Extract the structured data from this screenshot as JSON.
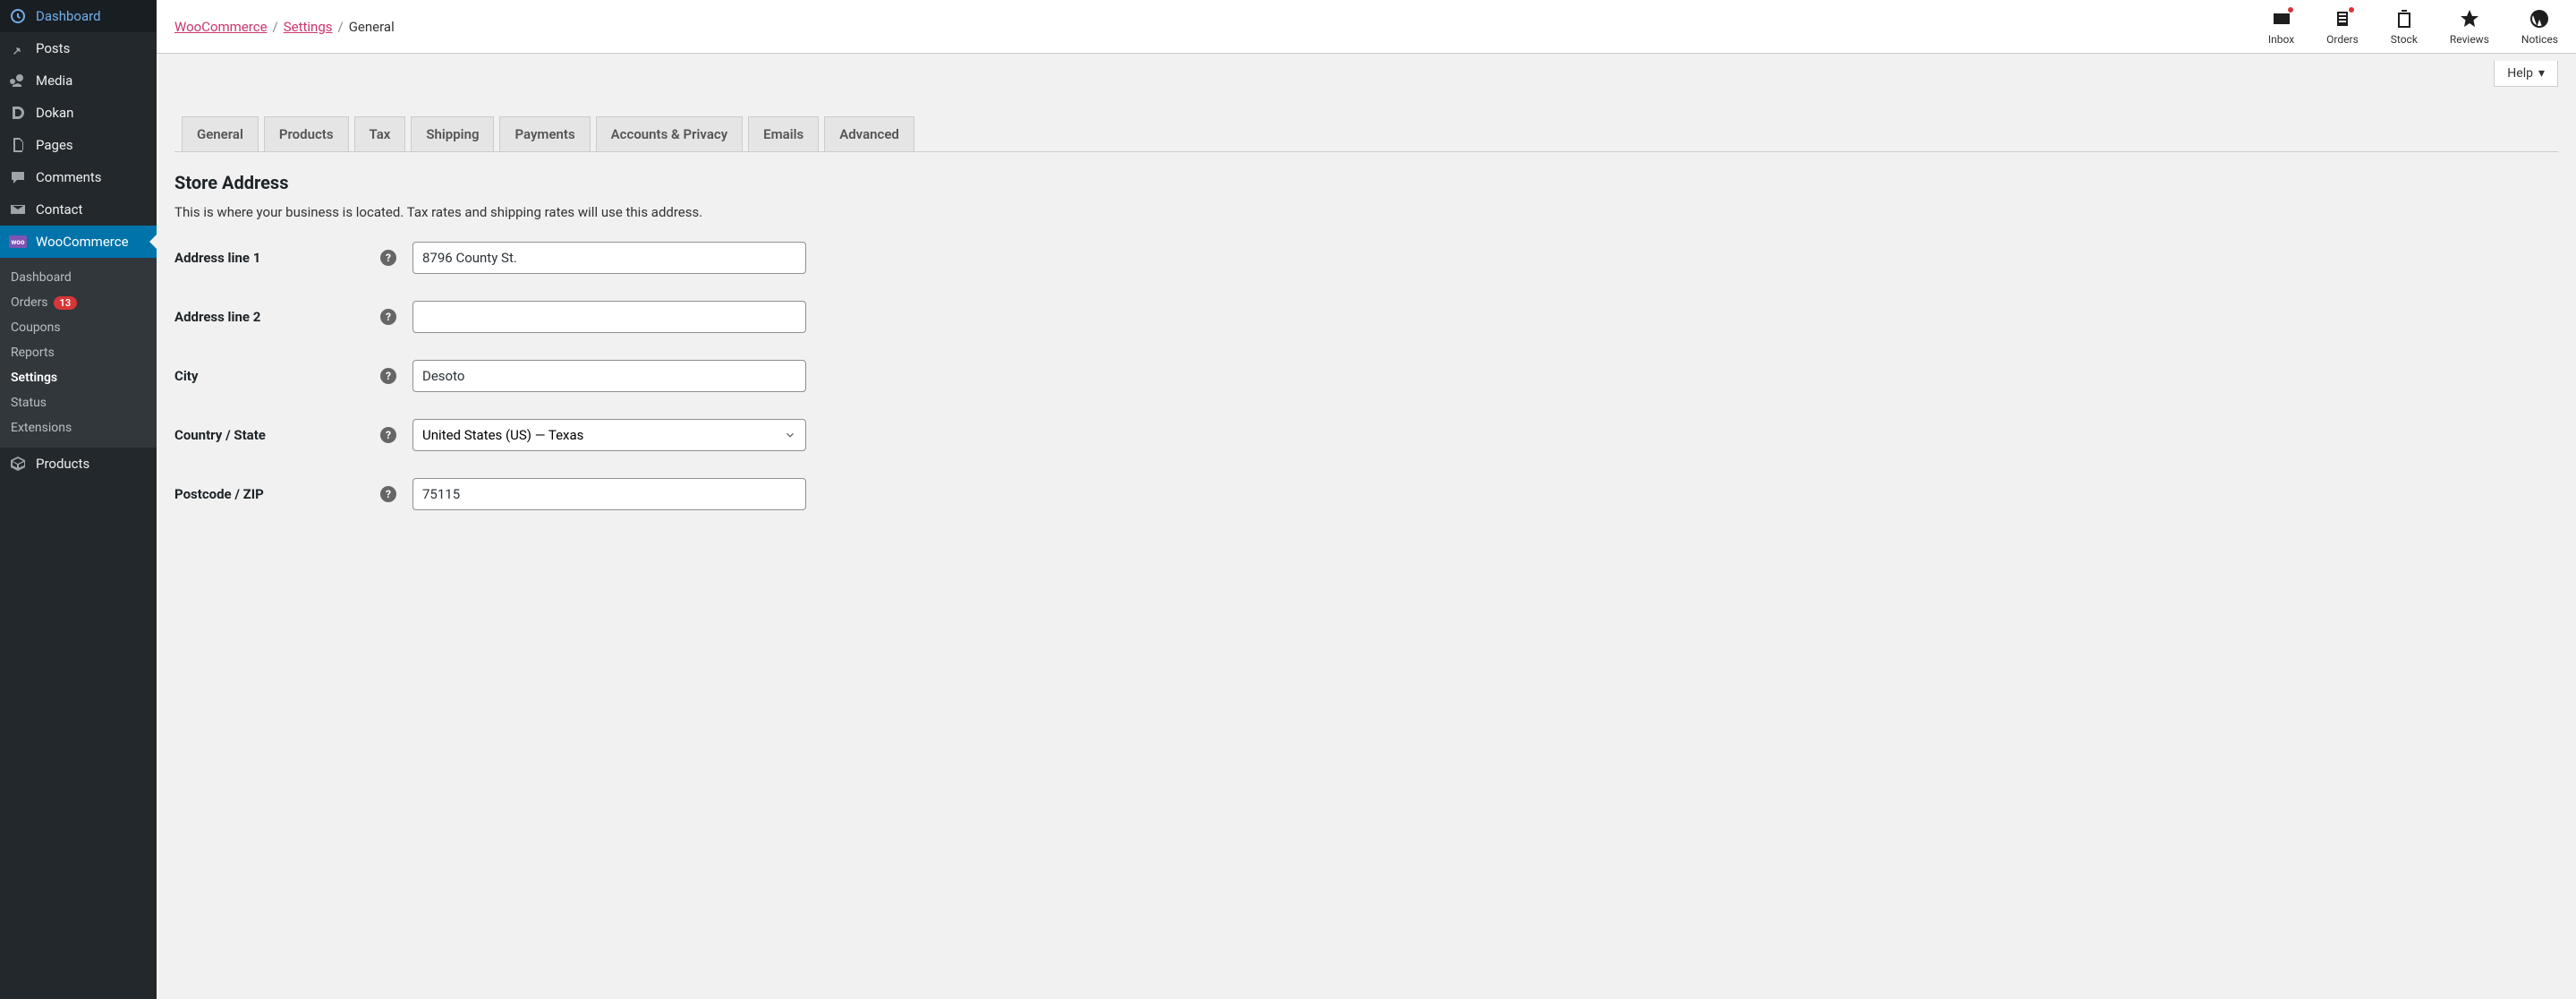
{
  "sidebar": {
    "items": [
      {
        "label": "Dashboard",
        "name": "dashboard"
      },
      {
        "label": "Posts",
        "name": "posts"
      },
      {
        "label": "Media",
        "name": "media"
      },
      {
        "label": "Dokan",
        "name": "dokan"
      },
      {
        "label": "Pages",
        "name": "pages"
      },
      {
        "label": "Comments",
        "name": "comments"
      },
      {
        "label": "Contact",
        "name": "contact"
      },
      {
        "label": "WooCommerce",
        "name": "woocommerce"
      },
      {
        "label": "Products",
        "name": "products"
      }
    ],
    "woo_submenu": {
      "dashboard": "Dashboard",
      "orders": "Orders",
      "orders_badge": "13",
      "coupons": "Coupons",
      "reports": "Reports",
      "settings": "Settings",
      "status": "Status",
      "extensions": "Extensions"
    }
  },
  "breadcrumb": {
    "woocommerce": "WooCommerce",
    "settings": "Settings",
    "general": "General"
  },
  "top_actions": {
    "inbox": "Inbox",
    "orders": "Orders",
    "stock": "Stock",
    "reviews": "Reviews",
    "notices": "Notices"
  },
  "help_tab": "Help",
  "tabs": {
    "general": "General",
    "products": "Products",
    "tax": "Tax",
    "shipping": "Shipping",
    "payments": "Payments",
    "accounts": "Accounts & Privacy",
    "emails": "Emails",
    "advanced": "Advanced"
  },
  "section": {
    "title": "Store Address",
    "desc": "This is where your business is located. Tax rates and shipping rates will use this address."
  },
  "form": {
    "address1_label": "Address line 1",
    "address1_value": "8796 County St.",
    "address2_label": "Address line 2",
    "address2_value": "",
    "city_label": "City",
    "city_value": "Desoto",
    "country_label": "Country / State",
    "country_value": "United States (US) — Texas",
    "postcode_label": "Postcode / ZIP",
    "postcode_value": "75115"
  }
}
